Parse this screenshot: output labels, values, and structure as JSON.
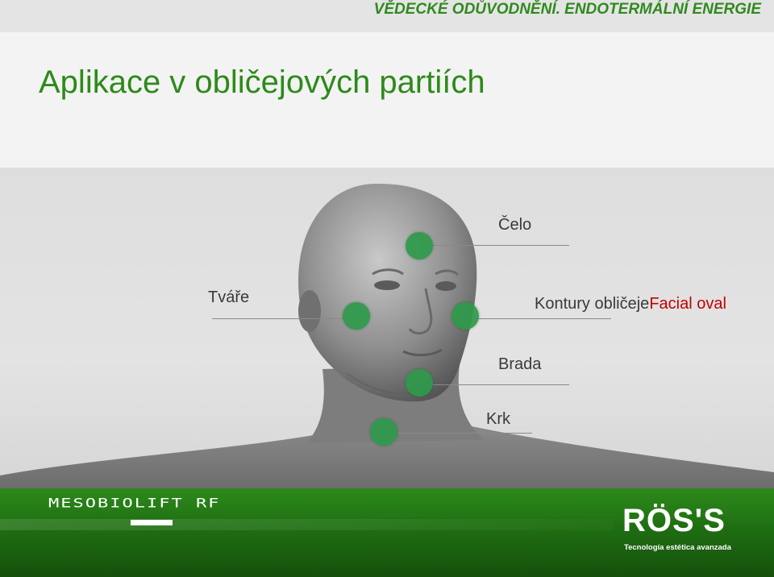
{
  "header": {
    "bar_text": "VĚDECKÉ ODŮVODNĚNÍ. ENDOTERMÁLNÍ ENERGIE",
    "bar_color": "#2f8a1e"
  },
  "title": {
    "text": "Aplikace v obličejových partiích",
    "color": "#2d8a19"
  },
  "zones": {
    "celo": "Čelo",
    "tvare": "Tváře",
    "kontury": "Kontury obličeje",
    "kontury_highlight": "Facial oval",
    "brada": "Brada",
    "krk": "Krk",
    "dot_color": "#2e9a4a",
    "highlight_color": "#c00000"
  },
  "footer": {
    "brand": "MESOBIOLIFT RF",
    "logo_name": "RÖS'S",
    "logo_tagline": "Tecnología estética avanzada",
    "bar_color": "#1f6e12"
  }
}
